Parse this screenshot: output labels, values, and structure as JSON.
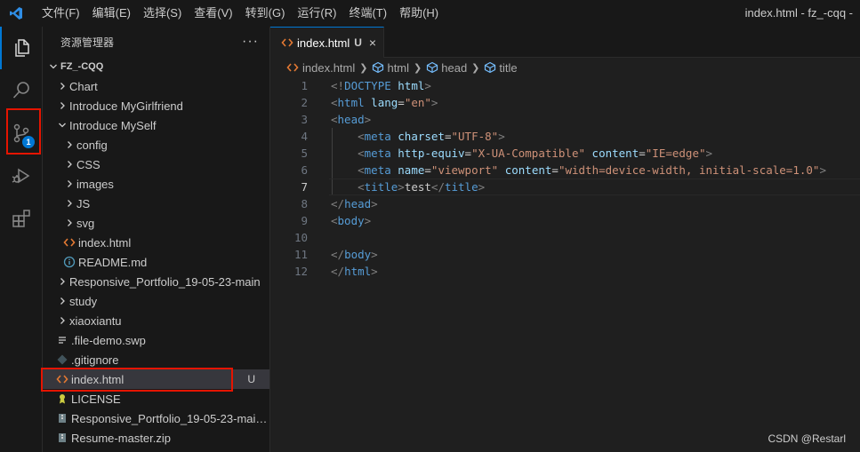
{
  "titlebar": {
    "menu": [
      "文件(F)",
      "编辑(E)",
      "选择(S)",
      "查看(V)",
      "转到(G)",
      "运行(R)",
      "终端(T)",
      "帮助(H)"
    ],
    "window_title": "index.html - fz_-cqq -"
  },
  "activitybar": {
    "source_control_badge": "1"
  },
  "sidebar": {
    "title": "资源管理器",
    "more": "···",
    "workspace": "FZ_-CQQ",
    "items": [
      {
        "label": "Chart",
        "kind": "folder",
        "expanded": false
      },
      {
        "label": "Introduce MyGirlfriend",
        "kind": "folder",
        "expanded": false
      },
      {
        "label": "Introduce MySelf",
        "kind": "folder",
        "expanded": true
      },
      {
        "label": "config",
        "kind": "folder",
        "expanded": false
      },
      {
        "label": "CSS",
        "kind": "folder",
        "expanded": false
      },
      {
        "label": "images",
        "kind": "folder",
        "expanded": false
      },
      {
        "label": "JS",
        "kind": "folder",
        "expanded": false
      },
      {
        "label": "svg",
        "kind": "folder",
        "expanded": false
      },
      {
        "label": "index.html",
        "kind": "html"
      },
      {
        "label": "README.md",
        "kind": "info"
      },
      {
        "label": "Responsive_Portfolio_19-05-23-main",
        "kind": "folder",
        "expanded": false
      },
      {
        "label": "study",
        "kind": "folder",
        "expanded": false
      },
      {
        "label": "xiaoxiantu",
        "kind": "folder",
        "expanded": false
      },
      {
        "label": ".file-demo.swp",
        "kind": "lines"
      },
      {
        "label": ".gitignore",
        "kind": "git"
      },
      {
        "label": "index.html",
        "kind": "html",
        "git_status": "U",
        "selected": true
      },
      {
        "label": "LICENSE",
        "kind": "license"
      },
      {
        "label": "Responsive_Portfolio_19-05-23-main...",
        "kind": "zip"
      },
      {
        "label": "Resume-master.zip",
        "kind": "zip"
      }
    ]
  },
  "editor": {
    "tab": {
      "label": "index.html",
      "status": "U",
      "close": "×"
    },
    "breadcrumb": [
      "index.html",
      "html",
      "head",
      "title"
    ],
    "line_numbers": [
      "1",
      "2",
      "3",
      "4",
      "5",
      "6",
      "7",
      "8",
      "9",
      "10",
      "11",
      "12"
    ],
    "current_line": "7"
  },
  "colors": {
    "accent": "#0078d4",
    "highlight_box": "#e51400",
    "html_icon": "#e37933",
    "tag": "#569cd6",
    "attr": "#9cdcfe",
    "string": "#ce9178"
  },
  "watermark": "CSDN @Restarl"
}
